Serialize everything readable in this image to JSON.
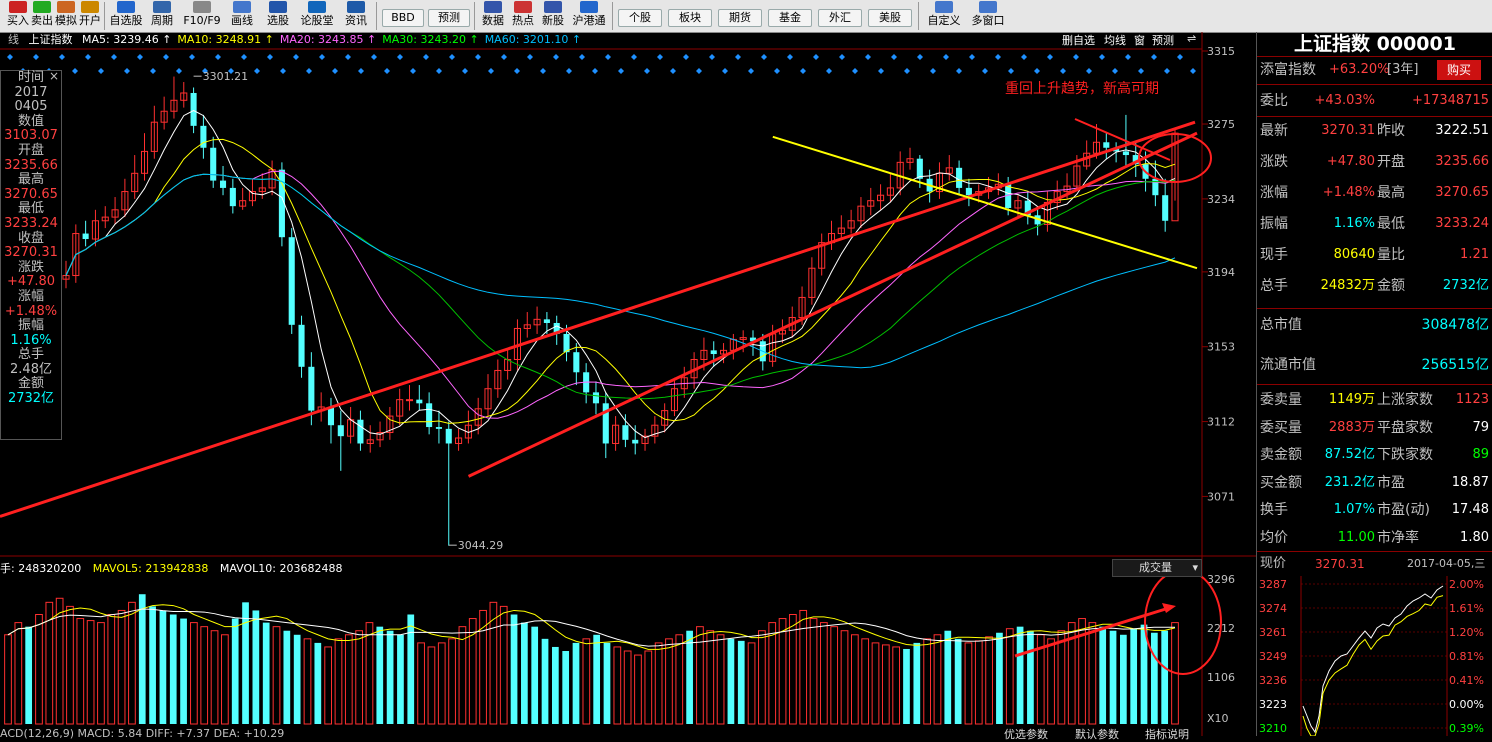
{
  "toolbar": {
    "items": [
      {
        "label": "买入",
        "color": "#cc2222"
      },
      {
        "label": "卖出",
        "color": "#22aa22"
      },
      {
        "label": "模拟",
        "color": "#cc6622"
      },
      {
        "label": "开户",
        "color": "#cc8800"
      },
      {
        "label": "自选股",
        "color": "#2266cc"
      },
      {
        "label": "周期",
        "color": "#3366aa"
      },
      {
        "label": "F10/F9",
        "color": "#888888"
      },
      {
        "label": "画线",
        "color": "#4477cc"
      },
      {
        "label": "选股",
        "color": "#2255aa"
      },
      {
        "label": "论股堂",
        "color": "#1166bb"
      },
      {
        "label": "资讯",
        "color": "#1e5aa8"
      }
    ],
    "pills_a": [
      "BBD",
      "预测"
    ],
    "items2": [
      {
        "label": "数据",
        "color": "#3355aa"
      },
      {
        "label": "热点",
        "color": "#cc3333"
      },
      {
        "label": "新股",
        "color": "#3355aa"
      },
      {
        "label": "沪港通",
        "color": "#2266cc"
      }
    ],
    "pills_b": [
      "个股",
      "板块",
      "期货",
      "基金",
      "外汇",
      "美股"
    ],
    "items3": [
      {
        "label": "自定义",
        "color": "#4477cc"
      },
      {
        "label": "多窗口",
        "color": "#4477cc"
      }
    ]
  },
  "info_bar": {
    "prefix": "线",
    "index_name": "上证指数",
    "ma": [
      {
        "label": "MA5: 3239.46",
        "color": "#ffffff"
      },
      {
        "label": "MA10: 3248.91",
        "color": "#ffff00"
      },
      {
        "label": "MA20: 3243.85",
        "color": "#ff66ff"
      },
      {
        "label": "MA30: 3243.20",
        "color": "#00ff00"
      },
      {
        "label": "MA60: 3201.10",
        "color": "#00bfff"
      }
    ]
  },
  "chart_tabs": [
    "删自选",
    "均线",
    "窗",
    "预测"
  ],
  "side_info": [
    {
      "text": "时间",
      "color": "#c0c0c0"
    },
    {
      "text": "2017",
      "color": "#c0c0c0"
    },
    {
      "text": "0405",
      "color": "#c0c0c0"
    },
    {
      "text": "数值",
      "color": "#c0c0c0"
    },
    {
      "text": "3103.07",
      "color": "#ff4040"
    },
    {
      "text": "开盘",
      "color": "#c0c0c0"
    },
    {
      "text": "3235.66",
      "color": "#ff4040"
    },
    {
      "text": "最高",
      "color": "#c0c0c0"
    },
    {
      "text": "3270.65",
      "color": "#ff4040"
    },
    {
      "text": "最低",
      "color": "#c0c0c0"
    },
    {
      "text": "3233.24",
      "color": "#ff4040"
    },
    {
      "text": "收盘",
      "color": "#c0c0c0"
    },
    {
      "text": "3270.31",
      "color": "#ff4040"
    },
    {
      "text": "涨跌",
      "color": "#c0c0c0"
    },
    {
      "text": "+47.80",
      "color": "#ff4040"
    },
    {
      "text": "涨幅",
      "color": "#c0c0c0"
    },
    {
      "text": "+1.48%",
      "color": "#ff4040"
    },
    {
      "text": "振幅",
      "color": "#c0c0c0"
    },
    {
      "text": "1.16%",
      "color": "#00ffff"
    },
    {
      "text": "总手",
      "color": "#c0c0c0"
    },
    {
      "text": "2.48亿",
      "color": "#c0c0c0"
    },
    {
      "text": "金额",
      "color": "#c0c0c0"
    },
    {
      "text": "2732亿",
      "color": "#00ffff"
    }
  ],
  "annotation": "重回上升趋势，新高可期",
  "volume_info": {
    "vol": "手: 248320200",
    "mavol5": "MAVOL5: 213942838",
    "mavol10": "MAVOL10: 203682488",
    "label": "成交量"
  },
  "bottom_tabs": [
    "优选参数",
    "默认参数",
    "指标说明"
  ],
  "bottom_indicator": "ACD(12,26,9)  MACD: 5.84  DIFF: +7.37  DEA: +10.29",
  "right_panel": {
    "title": "上证指数 000001",
    "tianfu": {
      "label": "添富指数",
      "value": "+63.20%",
      "period": "[3年]",
      "button": "购买"
    },
    "weibi": {
      "label": "委比",
      "pct": "+43.03%",
      "num": "+17348715"
    },
    "quote_rows": [
      {
        "l1": "最新",
        "v1": "3270.31",
        "c1": "#ff4040",
        "l2": "昨收",
        "v2": "3222.51",
        "c2": "#ffffff"
      },
      {
        "l1": "涨跌",
        "v1": "+47.80",
        "c1": "#ff4040",
        "l2": "开盘",
        "v2": "3235.66",
        "c2": "#ff4040"
      },
      {
        "l1": "涨幅",
        "v1": "+1.48%",
        "c1": "#ff4040",
        "l2": "最高",
        "v2": "3270.65",
        "c2": "#ff4040"
      },
      {
        "l1": "振幅",
        "v1": "1.16%",
        "c1": "#00ffff",
        "l2": "最低",
        "v2": "3233.24",
        "c2": "#ff4040"
      },
      {
        "l1": "现手",
        "v1": "80640",
        "c1": "#ffff00",
        "l2": "量比",
        "v2": "1.21",
        "c2": "#ff4040"
      },
      {
        "l1": "总手",
        "v1": "24832万",
        "c1": "#ffff00",
        "l2": "金额",
        "v2": "2732亿",
        "c2": "#00ffff"
      }
    ],
    "market_cap": {
      "label": "总市值",
      "value": "308478亿"
    },
    "float_cap": {
      "label": "流通市值",
      "value": "256515亿"
    },
    "stat_rows": [
      {
        "l1": "委卖量",
        "v1": "1149万",
        "c1": "#ffff00",
        "l2": "上涨家数",
        "v2": "1123",
        "c2": "#ff4040"
      },
      {
        "l1": "委买量",
        "v1": "2883万",
        "c1": "#ff4040",
        "l2": "平盘家数",
        "v2": "79",
        "c2": "#ffffff"
      },
      {
        "l1": "卖金额",
        "v1": "87.52亿",
        "c1": "#00ffff",
        "l2": "下跌家数",
        "v2": "89",
        "c2": "#00ff00"
      },
      {
        "l1": "买金额",
        "v1": "231.2亿",
        "c1": "#00ffff",
        "l2": "市盈",
        "v2": "18.87",
        "c2": "#ffffff"
      },
      {
        "l1": "换手",
        "v1": "1.07%",
        "c1": "#00ffff",
        "l2": "市盈(动)",
        "v2": "17.48",
        "c2": "#ffffff"
      },
      {
        "l1": "均价",
        "v1": "11.00",
        "c1": "#00ff00",
        "l2": "市净率",
        "v2": "1.80",
        "c2": "#ffffff"
      }
    ],
    "intraday": {
      "label": "现价",
      "price": "3270.31",
      "date": "2017-04-05,三"
    }
  },
  "chart_data": [
    {
      "type": "candlestick",
      "title": "上证指数 日K线",
      "ylim": [
        3050,
        3315
      ],
      "y_ticks": [
        "3315",
        "3275",
        "3234",
        "3194",
        "3153",
        "3112",
        "3071"
      ],
      "y_tick_values": [
        3315,
        3275,
        3234,
        3194,
        3153,
        3112,
        3071
      ],
      "annotations": [
        {
          "text": "3301.21",
          "date": "2016-11-29",
          "value": 3301.21
        },
        {
          "text": "3044.29",
          "date": "2017-01-16",
          "value": 3044.29
        }
      ],
      "open": [
        3190,
        3192,
        3215,
        3212,
        3222,
        3224,
        3228,
        3238,
        3248,
        3260,
        3276,
        3282,
        3288,
        3292,
        3274,
        3262,
        3244,
        3240,
        3230,
        3233,
        3238,
        3240,
        3250,
        3213,
        3165,
        3142,
        3118,
        3120,
        3110,
        3104,
        3113,
        3100,
        3102,
        3106,
        3115,
        3124,
        3124,
        3122,
        3109,
        3108,
        3100,
        3103,
        3110,
        3119,
        3130,
        3140,
        3146,
        3163,
        3165,
        3168,
        3166,
        3160,
        3150,
        3139,
        3128,
        3122,
        3100,
        3110,
        3102,
        3100,
        3104,
        3110,
        3118,
        3130,
        3136,
        3146,
        3151,
        3149,
        3151,
        3157,
        3158,
        3156,
        3145,
        3160,
        3162,
        3169,
        3180,
        3196,
        3210,
        3215,
        3218,
        3222,
        3230,
        3233,
        3236,
        3240,
        3254,
        3256,
        3245,
        3238,
        3248,
        3251,
        3240,
        3236,
        3238,
        3240,
        3242,
        3229,
        3233,
        3225,
        3220,
        3232,
        3238,
        3241,
        3252,
        3259,
        3265,
        3262,
        3260,
        3258,
        3253,
        3245,
        3236,
        3222
      ],
      "close": [
        3192,
        3215,
        3212,
        3222,
        3224,
        3228,
        3238,
        3248,
        3260,
        3276,
        3282,
        3288,
        3292,
        3274,
        3262,
        3244,
        3240,
        3230,
        3233,
        3238,
        3240,
        3250,
        3213,
        3165,
        3142,
        3118,
        3120,
        3110,
        3104,
        3113,
        3100,
        3102,
        3106,
        3115,
        3124,
        3124,
        3122,
        3109,
        3108,
        3100,
        3103,
        3110,
        3119,
        3130,
        3140,
        3146,
        3163,
        3165,
        3168,
        3166,
        3160,
        3150,
        3139,
        3128,
        3122,
        3100,
        3110,
        3102,
        3100,
        3104,
        3110,
        3118,
        3130,
        3136,
        3146,
        3151,
        3149,
        3151,
        3157,
        3158,
        3156,
        3145,
        3160,
        3162,
        3169,
        3180,
        3196,
        3210,
        3215,
        3218,
        3222,
        3230,
        3233,
        3236,
        3240,
        3254,
        3256,
        3245,
        3238,
        3248,
        3251,
        3240,
        3236,
        3238,
        3240,
        3242,
        3229,
        3233,
        3225,
        3220,
        3232,
        3238,
        3241,
        3252,
        3259,
        3265,
        3262,
        3260,
        3258,
        3253,
        3245,
        3236,
        3222,
        3270
      ],
      "high": [
        3200,
        3220,
        3222,
        3228,
        3230,
        3235,
        3245,
        3258,
        3270,
        3285,
        3290,
        3301,
        3298,
        3295,
        3280,
        3268,
        3252,
        3245,
        3240,
        3245,
        3248,
        3255,
        3254,
        3218,
        3170,
        3150,
        3128,
        3125,
        3118,
        3120,
        3118,
        3110,
        3112,
        3120,
        3130,
        3132,
        3132,
        3128,
        3118,
        3112,
        3108,
        3118,
        3125,
        3138,
        3146,
        3152,
        3168,
        3172,
        3175,
        3172,
        3170,
        3165,
        3155,
        3144,
        3134,
        3128,
        3115,
        3116,
        3110,
        3108,
        3115,
        3122,
        3136,
        3142,
        3150,
        3158,
        3156,
        3155,
        3160,
        3162,
        3162,
        3160,
        3165,
        3168,
        3175,
        3186,
        3202,
        3215,
        3222,
        3225,
        3228,
        3235,
        3240,
        3242,
        3248,
        3260,
        3262,
        3258,
        3250,
        3254,
        3258,
        3255,
        3245,
        3242,
        3246,
        3248,
        3246,
        3236,
        3238,
        3230,
        3238,
        3244,
        3248,
        3258,
        3266,
        3275,
        3270,
        3265,
        3280,
        3265,
        3260,
        3255,
        3245,
        3272
      ],
      "low": [
        3185,
        3188,
        3208,
        3208,
        3218,
        3220,
        3224,
        3234,
        3244,
        3256,
        3272,
        3278,
        3284,
        3270,
        3256,
        3240,
        3236,
        3226,
        3228,
        3230,
        3234,
        3236,
        3208,
        3160,
        3136,
        3110,
        3112,
        3100,
        3085,
        3100,
        3096,
        3095,
        3098,
        3102,
        3110,
        3118,
        3118,
        3105,
        3100,
        3044,
        3096,
        3100,
        3105,
        3115,
        3125,
        3135,
        3140,
        3158,
        3160,
        3160,
        3154,
        3145,
        3132,
        3122,
        3116,
        3092,
        3096,
        3098,
        3094,
        3096,
        3100,
        3106,
        3115,
        3125,
        3130,
        3140,
        3142,
        3144,
        3146,
        3150,
        3148,
        3140,
        3142,
        3155,
        3158,
        3165,
        3176,
        3192,
        3206,
        3212,
        3215,
        3218,
        3225,
        3228,
        3232,
        3236,
        3250,
        3240,
        3232,
        3234,
        3244,
        3236,
        3230,
        3232,
        3234,
        3236,
        3225,
        3224,
        3220,
        3214,
        3216,
        3228,
        3234,
        3238,
        3250,
        3256,
        3256,
        3254,
        3252,
        3246,
        3238,
        3230,
        3216,
        3233
      ]
    },
    {
      "type": "bar",
      "title": "成交量",
      "y_ticks": [
        "3296",
        "2212",
        "1106",
        "X10"
      ],
      "ylim": [
        0,
        3600
      ],
      "values": [
        220,
        250,
        240,
        270,
        300,
        310,
        290,
        260,
        255,
        250,
        270,
        280,
        300,
        320,
        290,
        280,
        270,
        260,
        250,
        240,
        230,
        220,
        260,
        300,
        280,
        250,
        240,
        230,
        220,
        210,
        200,
        190,
        210,
        220,
        230,
        250,
        240,
        230,
        220,
        270,
        200,
        190,
        200,
        210,
        240,
        260,
        280,
        300,
        290,
        270,
        250,
        240,
        210,
        190,
        180,
        200,
        210,
        220,
        200,
        190,
        180,
        170,
        180,
        200,
        210,
        220,
        230,
        240,
        230,
        220,
        210,
        205,
        200,
        230,
        250,
        260,
        270,
        280,
        260,
        250,
        240,
        230,
        220,
        210,
        200,
        195,
        190,
        185,
        200,
        210,
        220,
        230,
        210,
        200,
        205,
        215,
        225,
        235,
        240,
        230,
        220,
        210,
        230,
        250,
        260,
        250,
        240,
        230,
        220,
        235,
        245,
        225,
        230,
        250
      ]
    }
  ]
}
